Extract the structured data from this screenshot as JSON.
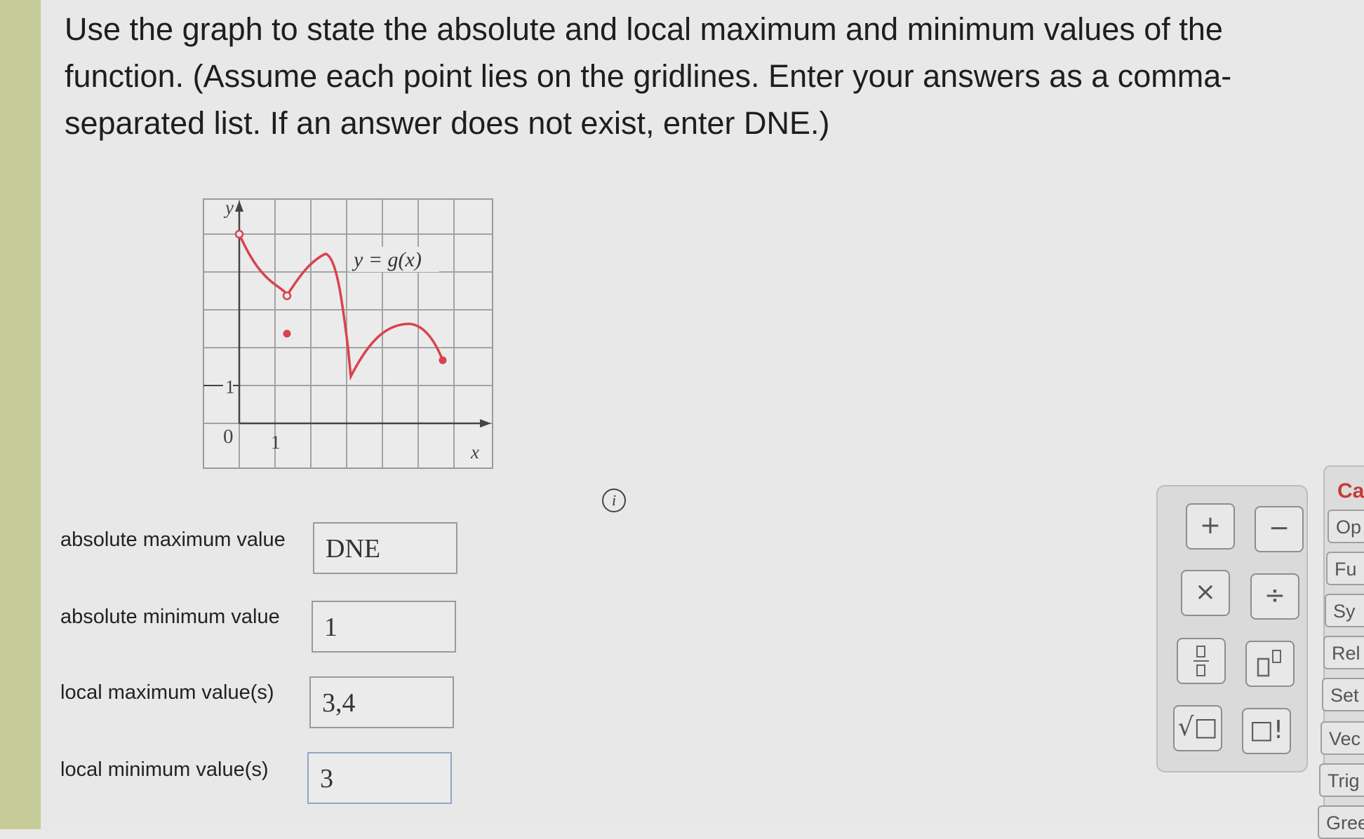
{
  "question": {
    "line1": "Use the graph to state the absolute and local maximum and minimum values of the",
    "line2": "function. (Assume each point lies on the gridlines. Enter your answers as a comma-",
    "line3": "separated list. If an answer does not exist, enter DNE.)"
  },
  "graph": {
    "y_axis_label": "y",
    "x_axis_label": "x",
    "function_label": "y = g(x)",
    "tick_y": "1",
    "tick_x": "1",
    "origin": "0",
    "curve_color": "#d8434f",
    "grid_color": "#9a9a9a"
  },
  "answers": [
    {
      "label": "absolute maximum value",
      "value": "DNE"
    },
    {
      "label": "absolute minimum value",
      "value": "1"
    },
    {
      "label": "local maximum value(s)",
      "value": "3,4"
    },
    {
      "label": "local minimum value(s)",
      "value": "3"
    }
  ],
  "info_icon": "i",
  "calculator": {
    "buttons": [
      "+",
      "−",
      "×",
      "÷",
      "fraction-template",
      "exponent-template",
      "√□",
      "□!"
    ]
  },
  "side_tabs": {
    "header": "Ca",
    "items": [
      "Op",
      "Fu",
      "Sy",
      "Rel",
      "Set",
      "Vec",
      "Trig",
      "Gree"
    ]
  }
}
